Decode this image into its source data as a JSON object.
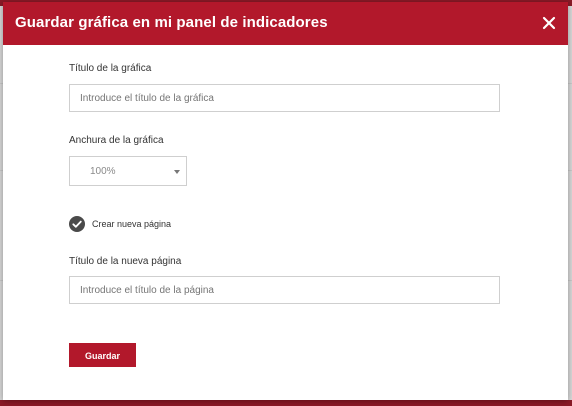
{
  "dialog": {
    "title": "Guardar gráfica en mi panel de indicadores",
    "close_icon": "close-icon",
    "header_color": "#b2182b"
  },
  "form": {
    "chart_title": {
      "label": "Título de la gráfica",
      "placeholder": "Introduce el título de la gráfica",
      "value": ""
    },
    "chart_width": {
      "label": "Anchura de la gráfica",
      "selected": "100%"
    },
    "new_page": {
      "label": "Crear nueva página",
      "checked": true,
      "icon": "check-circle-icon"
    },
    "page_title": {
      "label": "Título de la nueva página",
      "placeholder": "Introduce el título de la página",
      "value": ""
    },
    "save_label": "Guardar"
  }
}
